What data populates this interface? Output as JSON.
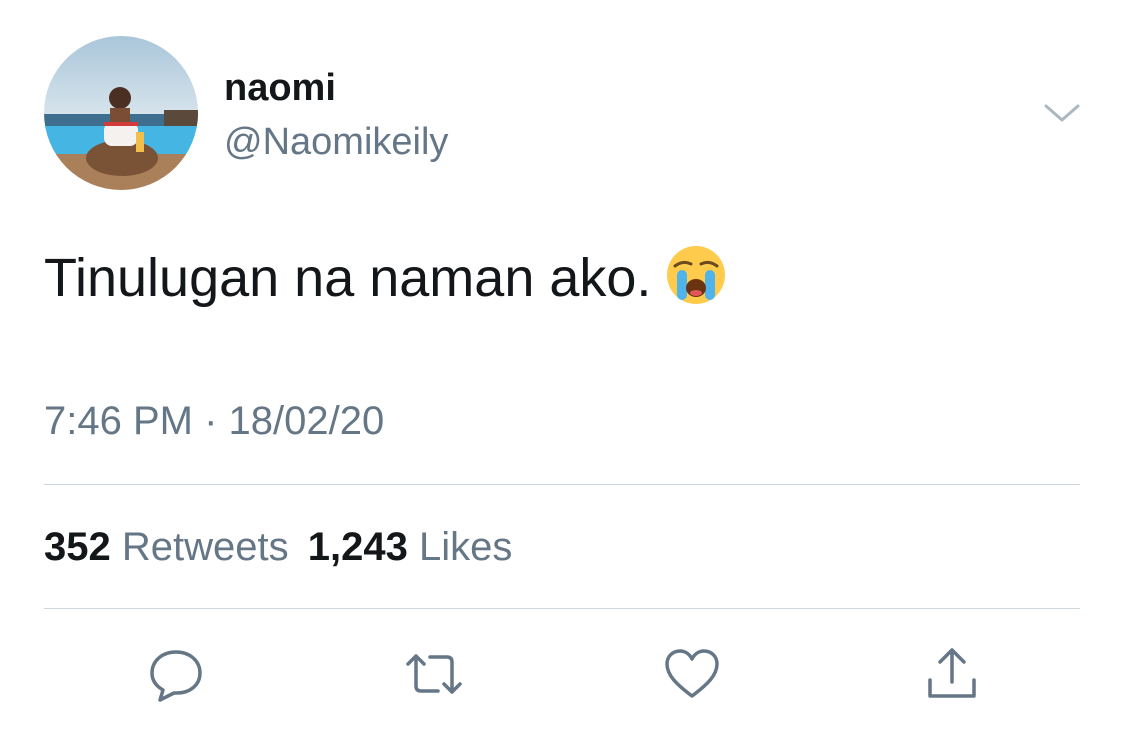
{
  "tweet": {
    "display_name": "naomi",
    "handle": "@Naomikeily",
    "text": "Tinulugan na naman ako.",
    "emoji": "loudly-crying-face",
    "timestamp": "7:46 PM · 18/02/20"
  },
  "stats": {
    "retweets_count": "352",
    "retweets_label": "Retweets",
    "likes_count": "1,243",
    "likes_label": "Likes"
  },
  "icons": {
    "menu": "chevron-down-icon",
    "reply": "reply-icon",
    "retweet": "retweet-icon",
    "like": "heart-icon",
    "share": "share-icon"
  },
  "colors": {
    "text_primary": "#14171a",
    "text_secondary": "#657786",
    "divider": "#ccd6dd",
    "icon": "#657786"
  }
}
